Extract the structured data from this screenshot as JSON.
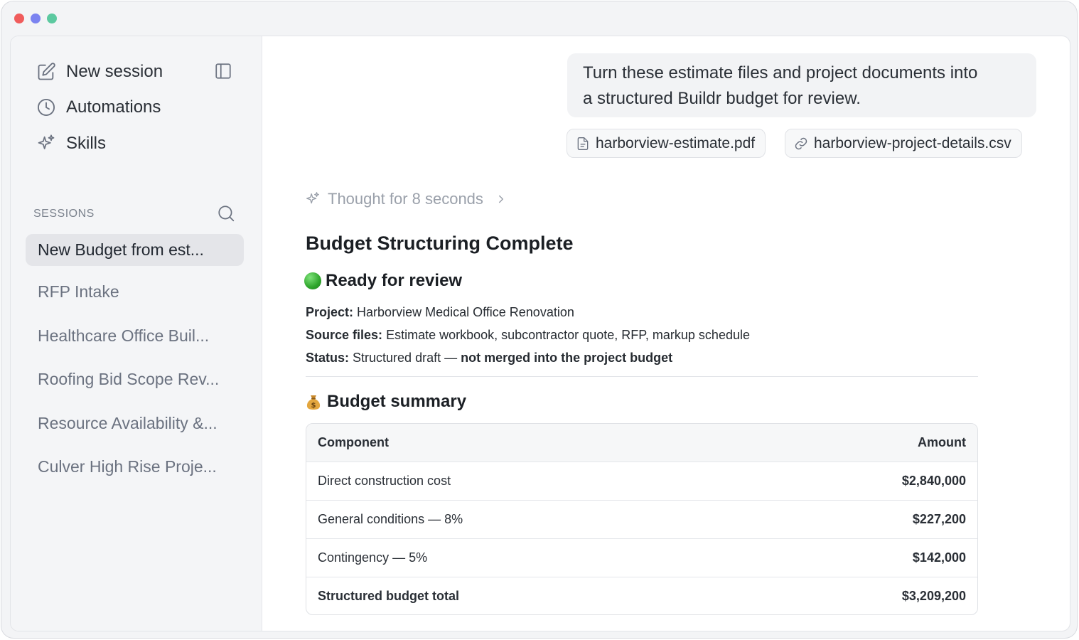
{
  "sidebar": {
    "nav": [
      {
        "label": "New session",
        "icon": "edit-icon"
      },
      {
        "label": "Automations",
        "icon": "clock-icon"
      },
      {
        "label": "Skills",
        "icon": "sparkle-icon"
      }
    ],
    "sessions_label": "SESSIONS",
    "sessions": [
      {
        "label": "New Budget from est...",
        "active": true
      },
      {
        "label": "RFP Intake"
      },
      {
        "label": "Healthcare Office Buil..."
      },
      {
        "label": "Roofing Bid Scope Rev..."
      },
      {
        "label": "Resource Availability &..."
      },
      {
        "label": "Culver High Rise Proje..."
      }
    ]
  },
  "chat": {
    "user_message_line1": "Turn these estimate files and project documents into",
    "user_message_line2": "a structured Buildr budget for review.",
    "attachments": [
      {
        "name": "harborview-estimate.pdf",
        "icon": "document-icon"
      },
      {
        "name": "harborview-project-details.csv",
        "icon": "link-icon"
      }
    ],
    "thought_label": "Thought for 8 seconds",
    "title": "Budget Structuring Complete",
    "status_heading": "Ready for review",
    "project_label": "Project:",
    "project_value": "Harborview Medical Office Renovation",
    "source_label": "Source files:",
    "source_value": "Estimate workbook, subcontractor quote, RFP, markup schedule",
    "status_label": "Status:",
    "status_value": "Structured draft —",
    "status_value_bold": "not merged into the project budget",
    "summary_heading": "Budget summary",
    "table": {
      "headers": [
        "Component",
        "Amount"
      ],
      "rows": [
        [
          "Direct construction cost",
          "$2,840,000"
        ],
        [
          "General conditions — 8%",
          "$227,200"
        ],
        [
          "Contingency — 5%",
          "$142,000"
        ],
        [
          "Structured budget total",
          "$3,209,200"
        ]
      ]
    }
  },
  "colors": {
    "accent_green": "#2ea52b",
    "traffic_red": "#f05c5c",
    "traffic_blue": "#7b83f0",
    "traffic_green": "#5cc9a0"
  }
}
